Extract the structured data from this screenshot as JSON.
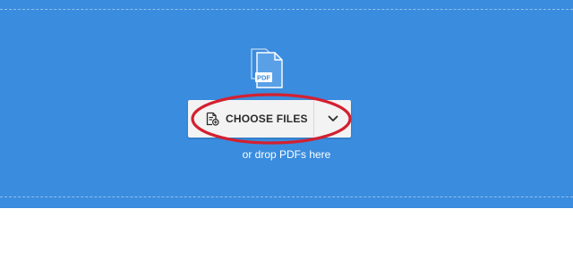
{
  "upload": {
    "file_badge": "PDF",
    "choose_label": "CHOOSE FILES",
    "drop_hint": "or drop PDFs here"
  },
  "icons": {
    "documents": "stacked-pdf-documents-icon",
    "add_file": "file-add-icon",
    "chevron": "chevron-down-icon"
  },
  "colors": {
    "dropzone_bg": "#3a8cde",
    "button_bg": "#f3f3f3",
    "highlight": "#d42030"
  }
}
